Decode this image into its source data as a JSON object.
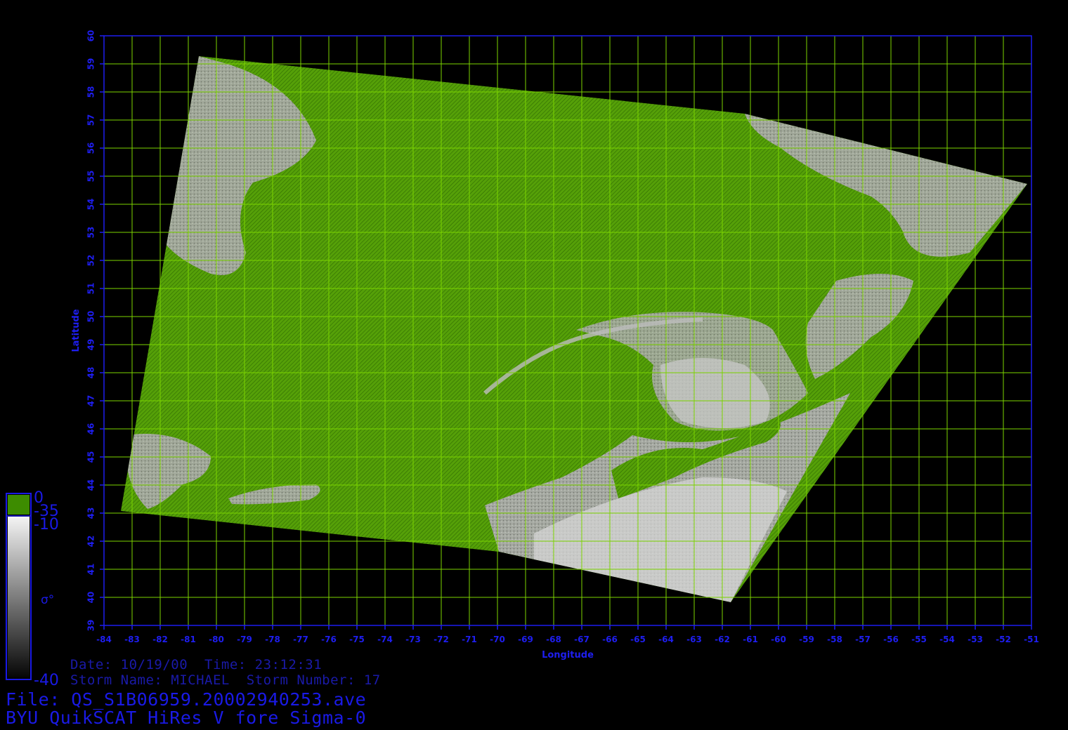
{
  "map": {
    "xlabel": "Longitude",
    "ylabel": "Latitude",
    "lon_range": [
      -84,
      -51
    ],
    "lat_range": [
      39,
      60
    ],
    "lon_ticks": [
      "-84",
      "-83",
      "-82",
      "-81",
      "-80",
      "-79",
      "-78",
      "-77",
      "-76",
      "-75",
      "-74",
      "-73",
      "-72",
      "-71",
      "-70",
      "-69",
      "-68",
      "-67",
      "-66",
      "-65",
      "-64",
      "-63",
      "-62",
      "-61",
      "-60",
      "-59",
      "-58",
      "-57",
      "-56",
      "-55",
      "-54",
      "-53",
      "-52",
      "-51"
    ],
    "lat_ticks": [
      "39",
      "40",
      "41",
      "42",
      "43",
      "44",
      "45",
      "46",
      "47",
      "48",
      "49",
      "50",
      "51",
      "52",
      "53",
      "54",
      "55",
      "56",
      "57",
      "58",
      "59",
      "60"
    ],
    "grid": true,
    "colors": {
      "grid": "#7cd400",
      "axis": "#1e1ef0",
      "ocean_green": "#4e9a06",
      "land_grey": "#b8b8b8",
      "background": "#000000"
    }
  },
  "colorbar": {
    "green_top": "0",
    "green_bottom": "-35",
    "grey_top": "-10",
    "grey_bottom": "-40",
    "symbol": "σ°"
  },
  "info": {
    "date_line": "Date: 10/19/00  Time: 23:12:31",
    "storm_line": "Storm Name: MICHAEL  Storm Number: 17",
    "file_line": "File: QS_S1B06959.20002940253.ave",
    "product_line": "BYU QuikSCAT HiRes V fore Sigma-0"
  }
}
